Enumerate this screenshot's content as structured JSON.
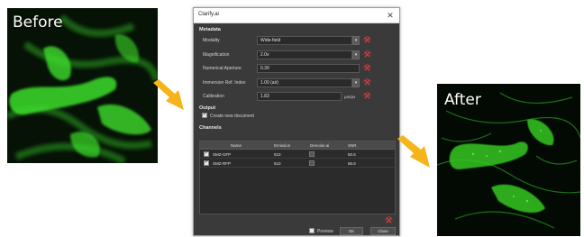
{
  "panels": {
    "before_label": "Before",
    "after_label": "After"
  },
  "colors": {
    "arrow": "#f5b41a",
    "fluorescence": "#3ddc2a",
    "dialog_bg": "#3a3a3a",
    "reset_icon": "#e0393e"
  },
  "dialog": {
    "title": "Clarify.ai",
    "metadata": {
      "heading": "Metadata",
      "fields": [
        {
          "label": "Modality",
          "value": "Wide-field",
          "type": "dropdown"
        },
        {
          "label": "Magnification",
          "value": "2.0x",
          "type": "dropdown"
        },
        {
          "label": "Numerical Aperture",
          "value": "0.30",
          "type": "text"
        },
        {
          "label": "Immersion Ref. Index",
          "value": "1.00 (air)",
          "type": "dropdown"
        },
        {
          "label": "Calibration",
          "value": "1.83",
          "type": "text",
          "unit": "µm/px"
        }
      ]
    },
    "output": {
      "heading": "Output",
      "create_new_document": "Create new document",
      "checked": true
    },
    "channels": {
      "heading": "Channels",
      "columns": [
        "Name",
        "Emission",
        "Denoise.ai",
        "SNR"
      ],
      "rows": [
        {
          "checked": true,
          "name": "SMZ-GFP",
          "emission": "510",
          "snr": "50.6"
        },
        {
          "checked": true,
          "name": "SMZ-RFP",
          "emission": "510",
          "snr": "56.6"
        }
      ]
    },
    "footer": {
      "preview": "Preview",
      "ok": "OK",
      "close": "Close"
    },
    "icons": {
      "reset": "reset-icon",
      "dropdown": "chevron-down-icon",
      "close": "close-icon"
    }
  }
}
